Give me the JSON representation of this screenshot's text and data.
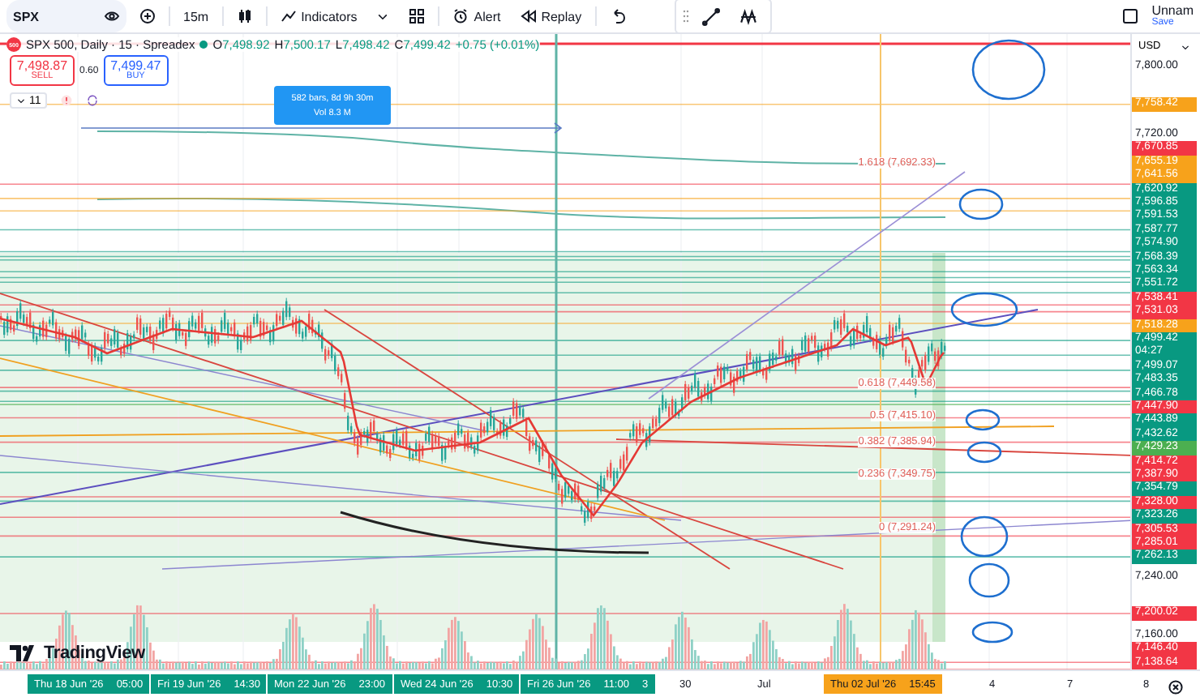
{
  "toolbar": {
    "symbol": "SPX",
    "interval": "15m",
    "buttons": [
      {
        "label": "Indicators",
        "kind": "indicators"
      },
      {
        "label": "Alert",
        "kind": "alert"
      },
      {
        "label": "Replay",
        "kind": "replay"
      }
    ],
    "layout": {
      "name": "Unnam",
      "action": "Save"
    }
  },
  "legend": {
    "logo": "500",
    "title": "SPX 500, Daily · 15 · Spreadex",
    "ohlc": [
      {
        "label": "O",
        "value": "7,498.92"
      },
      {
        "label": "H",
        "value": "7,500.17"
      },
      {
        "label": "L",
        "value": "7,498.42"
      },
      {
        "label": "C",
        "value": "7,499.42"
      }
    ],
    "change": "+0.75 (+0.01%)",
    "sell": {
      "price": "7,498.87",
      "label": "SELL"
    },
    "spread": "0.60",
    "buy": {
      "price": "7,499.47",
      "label": "BUY"
    },
    "indicators_count": "11"
  },
  "measure_tooltip": {
    "lines": [
      "582 bars, 8d 9h 30m",
      "Vol 8.3 M"
    ]
  },
  "fib_labels": [
    "1.618 (7,692.33)",
    "0.618 (7,449.58)",
    "0.5 (7,415.10)",
    "0.382 (7,385.94)",
    "0.236 (7,349.75)",
    "0 (7,291.24)"
  ],
  "branding": "TradingView",
  "price_axis": {
    "currency": "USD",
    "labels": [
      {
        "text": "7,800.00",
        "kind": "scale"
      },
      {
        "text": "7,758.42",
        "kind": "line",
        "color": "#f7a21b"
      },
      {
        "text": "7,720.00",
        "kind": "scale"
      },
      {
        "text": "7,670.85",
        "kind": "line",
        "color": "#f23645"
      },
      {
        "text": "7,655.19",
        "kind": "line",
        "color": "#f7a21b"
      },
      {
        "text": "7,641.56",
        "kind": "line",
        "color": "#f7a21b"
      },
      {
        "text": "7,620.92",
        "kind": "line",
        "color": "#089981"
      },
      {
        "text": "7,596.85",
        "kind": "line",
        "color": "#089981"
      },
      {
        "text": "7,591.53",
        "kind": "line",
        "color": "#089981"
      },
      {
        "text": "7,587.77",
        "kind": "line",
        "color": "#089981"
      },
      {
        "text": "7,574.90",
        "kind": "line",
        "color": "#089981"
      },
      {
        "text": "7,568.39",
        "kind": "line",
        "color": "#089981"
      },
      {
        "text": "7,563.34",
        "kind": "line",
        "color": "#089981"
      },
      {
        "text": "7,551.72",
        "kind": "line",
        "color": "#089981"
      },
      {
        "text": "7,538.41",
        "kind": "line",
        "color": "#f23645"
      },
      {
        "text": "7,531.03",
        "kind": "line",
        "color": "#f23645"
      },
      {
        "text": "7,518.28",
        "kind": "line",
        "color": "#f7a21b"
      },
      {
        "text": "7,499.42",
        "kind": "line",
        "color": "#089981",
        "countdown": "04:27"
      },
      {
        "text": "7,499.07",
        "kind": "line",
        "color": "#089981"
      },
      {
        "text": "7,483.35",
        "kind": "line",
        "color": "#089981"
      },
      {
        "text": "7,466.78",
        "kind": "line",
        "color": "#089981"
      },
      {
        "text": "7,447.90",
        "kind": "line",
        "color": "#f23645"
      },
      {
        "text": "7,443.89",
        "kind": "line",
        "color": "#089981"
      },
      {
        "text": "7,432.62",
        "kind": "line",
        "color": "#089981"
      },
      {
        "text": "7,429.23",
        "kind": "line",
        "color": "#4caf50"
      },
      {
        "text": "7,414.72",
        "kind": "line",
        "color": "#f23645"
      },
      {
        "text": "7,387.90",
        "kind": "line",
        "color": "#f23645"
      },
      {
        "text": "7,354.79",
        "kind": "line",
        "color": "#089981"
      },
      {
        "text": "7,328.00",
        "kind": "line",
        "color": "#f23645"
      },
      {
        "text": "7,323.26",
        "kind": "line",
        "color": "#089981"
      },
      {
        "text": "7,305.53",
        "kind": "line",
        "color": "#f23645"
      },
      {
        "text": "7,285.01",
        "kind": "line",
        "color": "#f23645"
      },
      {
        "text": "7,262.13",
        "kind": "line",
        "color": "#089981"
      },
      {
        "text": "7,240.00",
        "kind": "scale"
      },
      {
        "text": "7,200.02",
        "kind": "line",
        "color": "#f23645"
      },
      {
        "text": "7,160.00",
        "kind": "scale"
      },
      {
        "text": "7,146.40",
        "kind": "line",
        "color": "#f23645"
      },
      {
        "text": "7,138.64",
        "kind": "line",
        "color": "#f23645"
      }
    ]
  },
  "time_axis": {
    "labels": [
      {
        "kind": "range",
        "parts": [
          "Thu 18 Jun '26",
          "05:00"
        ]
      },
      {
        "kind": "range",
        "parts": [
          "Fri 19 Jun '26",
          "14:30"
        ]
      },
      {
        "kind": "range",
        "parts": [
          "Mon 22 Jun '26",
          "23:00"
        ]
      },
      {
        "kind": "range",
        "parts": [
          "Wed 24 Jun '26",
          "10:30"
        ]
      },
      {
        "kind": "range",
        "parts": [
          "Fri 26 Jun '26",
          "11:00",
          "3"
        ]
      },
      {
        "kind": "tick",
        "parts": [
          "30"
        ]
      },
      {
        "kind": "tick",
        "parts": [
          "Jul"
        ]
      },
      {
        "kind": "cursor",
        "parts": [
          "Thu 02 Jul '26",
          "15:45"
        ]
      },
      {
        "kind": "tick",
        "parts": [
          "4"
        ]
      },
      {
        "kind": "tick",
        "parts": [
          "7"
        ]
      },
      {
        "kind": "tick",
        "parts": [
          "8"
        ]
      }
    ]
  }
}
